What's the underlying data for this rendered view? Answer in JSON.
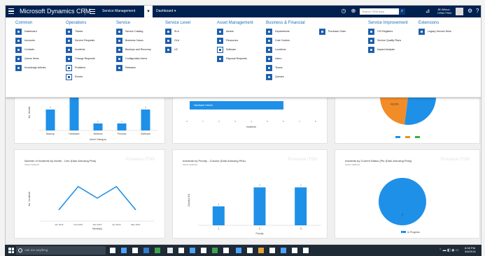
{
  "topbar": {
    "app_title": "Microsoft Dynamics CRM",
    "area": "Service Management",
    "area_caret": "▾",
    "dashboard": "Dashboard ▾",
    "search_placeholder": "Search CRM data",
    "user_name": "JB Wilson",
    "user_org": "CRM ITSM"
  },
  "sitemap": {
    "columns": [
      {
        "title": "Common",
        "items": [
          "Dashboard",
          "Accounts",
          "Contacts",
          "Queue Items",
          "Knowledge Articles"
        ]
      },
      {
        "title": "Operations",
        "items": [
          "Tickets",
          "Service Requests",
          "Incidents",
          "Change Requests",
          "Problems",
          "Events"
        ]
      },
      {
        "title": "Service",
        "items": [
          "Service Catalog",
          "Business Cases",
          "Backups and Recovery",
          "Configuration Items",
          "Releases"
        ]
      },
      {
        "title": "Service Level",
        "items": [
          "SLA",
          "OLA",
          "UC"
        ]
      },
      {
        "title": "Asset Management",
        "items": [
          "Assets",
          "Resources",
          "Software",
          "Disposal Requests"
        ]
      },
      {
        "title": "Business & Financial",
        "items": [
          "Departments",
          "Cost Centers",
          "Locations",
          "Users",
          "Teams",
          "Queues"
        ]
      },
      {
        "title": "",
        "items": [
          "Purchase Order"
        ]
      },
      {
        "title": "Service Improvement",
        "items": [
          "CSI Registers",
          "Service Quality Plans",
          "Impact Analysis"
        ]
      },
      {
        "title": "Extensions",
        "items": [
          "Legacy Service Desk"
        ]
      }
    ]
  },
  "panels": {
    "p1": {
      "xlabel": "Asset Category"
    },
    "p2": {
      "bar_label": "Hardware Failure",
      "xlabel": "Incidents"
    },
    "p4": {
      "title": "Number of Incidents by Month - Line (Dark Amusing Pink)",
      "subtitle": "Active Incidents",
      "watermark": "Provance ITSM",
      "ylabel": "No. Incidents",
      "xlabel": "Month(s)"
    },
    "p5": {
      "title": "Incidents by Priority - Column (Dark Amusing Pink)",
      "subtitle": "Active Incidents",
      "watermark": "Provance ITSM",
      "ylabel": "Count(# ID)",
      "xlabel": "Priority"
    },
    "p6": {
      "title": "Incidents by Current Status (Pie (Dark Amusing Pink))",
      "subtitle": "Active Incidents",
      "watermark": "Provance ITSM",
      "legend": "In Progress"
    }
  },
  "chart_data": [
    {
      "type": "bar",
      "categories": [
        "Backup",
        "Hardware",
        "Network",
        "Process",
        "Software"
      ],
      "values": [
        3,
        5,
        1,
        1,
        3
      ],
      "xlabel": "Asset Category",
      "ylabel": "No. Assets",
      "ylim": [
        0,
        5
      ],
      "colors": [
        "#1e90e8"
      ]
    },
    {
      "type": "bar",
      "orientation": "horizontal",
      "categories": [
        "Hardware Failure"
      ],
      "values": [
        6
      ],
      "xlabel": "Incidents",
      "xlim": [
        0,
        8
      ],
      "xticks": [
        0,
        1,
        2,
        3,
        4,
        5,
        6,
        7,
        8
      ],
      "colors": [
        "#1e90e8"
      ]
    },
    {
      "type": "pie",
      "labels": [
        "Blue",
        "Orange",
        "Green"
      ],
      "values": [
        52,
        30,
        18
      ],
      "data_labels": [
        "",
        "48.33%",
        ""
      ],
      "colors": [
        "#1e90e8",
        "#f28c28",
        "#36b336"
      ]
    },
    {
      "type": "line",
      "title": "Number of Incidents by Month - Line (Dark Amusing Pink)",
      "x": [
        "Jan 2016",
        "Feb 2016",
        "Mar 2016",
        "Apr 2016",
        "May 2016"
      ],
      "values": [
        1,
        3,
        2,
        3,
        1
      ],
      "xlabel": "Month(s)",
      "ylabel": "No. Incidents",
      "ylim": [
        0,
        4
      ],
      "colors": [
        "#1e90e8"
      ]
    },
    {
      "type": "bar",
      "title": "Incidents by Priority - Column (Dark Amusing Pink)",
      "categories": [
        "1",
        "2",
        "3"
      ],
      "values": [
        2,
        4,
        4
      ],
      "xlabel": "Priority",
      "ylabel": "Count(# ID)",
      "ylim": [
        0,
        5
      ],
      "colors": [
        "#1e90e8"
      ]
    },
    {
      "type": "pie",
      "title": "Incidents by Current Status (Pie (Dark Amusing Pink))",
      "labels": [
        "In Progress"
      ],
      "values": [
        100
      ],
      "data_labels": [
        "3"
      ],
      "colors": [
        "#1e90e8"
      ]
    }
  ],
  "taskbar": {
    "search_placeholder": "Ask me anything",
    "clock_time": "8:08 PM",
    "clock_date": "3/6/2016"
  }
}
